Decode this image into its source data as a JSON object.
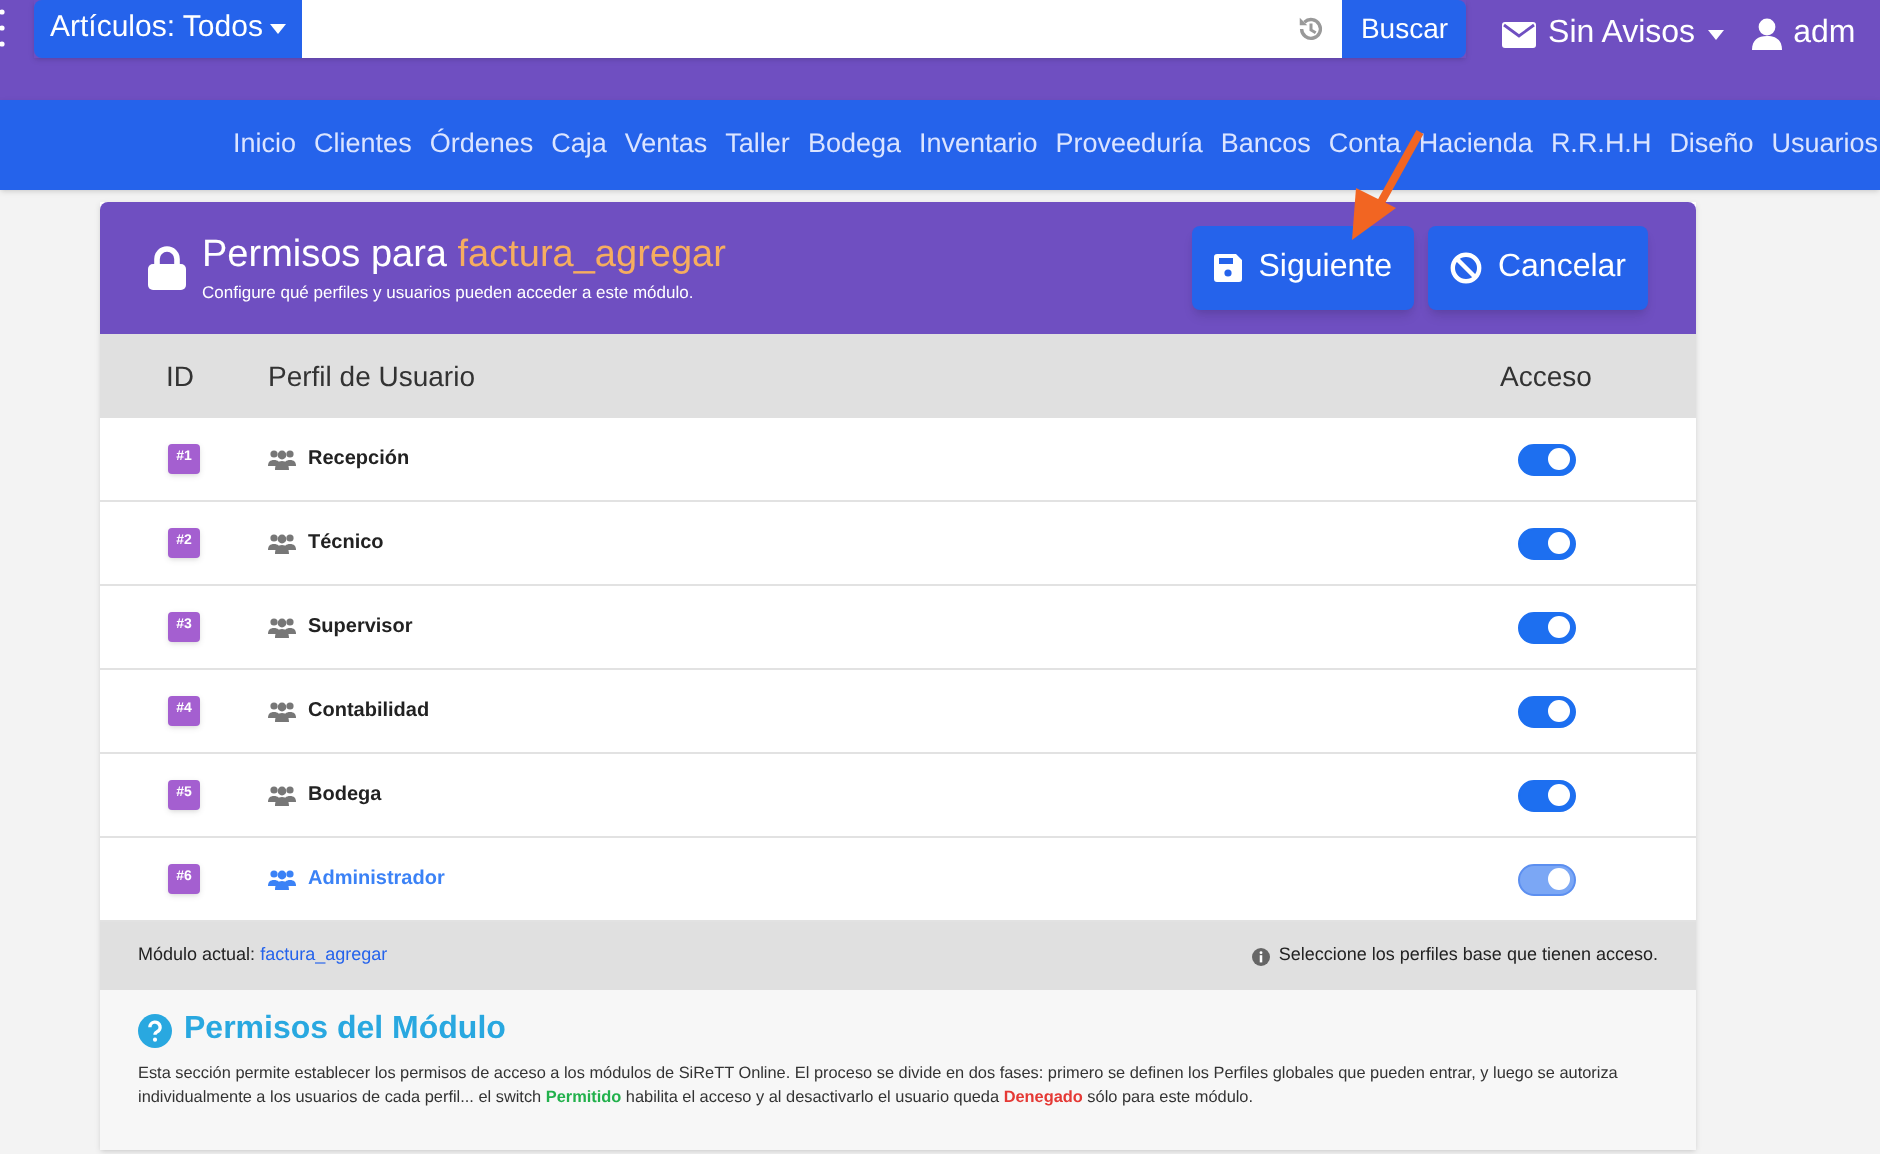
{
  "topbar": {
    "category_button": "Artículos: Todos",
    "search_button": "Buscar",
    "notifications": "Sin Avisos",
    "user": "adm"
  },
  "nav": [
    "Inicio",
    "Clientes",
    "Órdenes",
    "Caja",
    "Ventas",
    "Taller",
    "Bodega",
    "Inventario",
    "Proveeduría",
    "Bancos",
    "Conta",
    "Hacienda",
    "R.R.H.H",
    "Diseño",
    "Usuarios"
  ],
  "card": {
    "title": "Permisos para",
    "module": "factura_agregar",
    "subtitle": "Configure qué perfiles y usuarios pueden acceder a este módulo.",
    "buttons": [
      {
        "label": "Siguiente",
        "kind": "save"
      },
      {
        "label": "Cancelar",
        "kind": "cancel"
      }
    ]
  },
  "table": {
    "columns": [
      "ID",
      "Perfil de Usuario",
      "Acceso"
    ],
    "rows": [
      {
        "id": "#1",
        "profile": "Recepción",
        "on": true,
        "locked": false
      },
      {
        "id": "#2",
        "profile": "Técnico",
        "on": true,
        "locked": false
      },
      {
        "id": "#3",
        "profile": "Supervisor",
        "on": true,
        "locked": false
      },
      {
        "id": "#4",
        "profile": "Contabilidad",
        "on": true,
        "locked": false
      },
      {
        "id": "#5",
        "profile": "Bodega",
        "on": true,
        "locked": false
      },
      {
        "id": "#6",
        "profile": "Administrador",
        "on": true,
        "locked": true
      }
    ]
  },
  "footer": {
    "label": "Módulo actual:",
    "module": "factura_agregar",
    "hint": "Seleccione los perfiles base que tienen acceso."
  },
  "help": {
    "title": "Permisos del Módulo",
    "paragraph": [
      {
        "text": "Esta sección permite establecer los permisos de acceso a los módulos de SiReTT Online. El proceso se divide en dos fases: primero se definen los Perfiles globales que pueden entrar, y luego se autoriza individualmente a los usuarios de cada perfil... el switch ",
        "kind": "plain"
      },
      {
        "text": "Permitido",
        "kind": "allowed"
      },
      {
        "text": " habilita el acceso y al desactivarlo el usuario queda ",
        "kind": "plain"
      },
      {
        "text": "Denegado",
        "kind": "denied"
      },
      {
        "text": " sólo para este módulo.",
        "kind": "plain"
      }
    ]
  }
}
